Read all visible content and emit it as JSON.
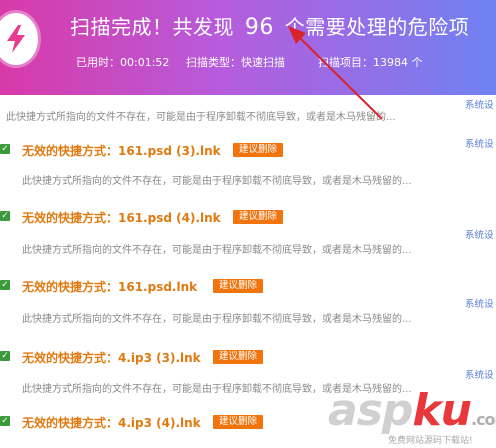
{
  "header": {
    "headline_prefix": "扫描完成！共发现",
    "count": "96",
    "headline_suffix": "个需要处理的危险项",
    "time_used": "已用时：00:01:52",
    "scan_type": "扫描类型：快速扫描",
    "scan_items": "扫描项目：13984 个",
    "logo_icon": "lightning-bolt-icon"
  },
  "desc_text": "此快捷方式所指向的文件不存在，可能是由于程序卸载不彻底导致，或者是木马残留的...",
  "tag_text": "系统设",
  "items": [
    {
      "title": "无效的快捷方式：161.psd (3).lnk",
      "action": "建议删除"
    },
    {
      "title": "无效的快捷方式：161.psd (4).lnk",
      "action": "建议删除"
    },
    {
      "title": "无效的快捷方式：161.psd.lnk",
      "action": "建议删除"
    },
    {
      "title": "无效的快捷方式：4.ip3 (3).lnk",
      "action": "建议删除"
    },
    {
      "title": "无效的快捷方式：4.ip3 (4).lnk",
      "action": "建议删除"
    }
  ],
  "watermark": {
    "asp": "asp",
    "ku": "ku",
    "suffix": ".com",
    "sub": "免费网站源码下载站!"
  },
  "colors": {
    "header_start": "#d83aa8",
    "header_end": "#6f82f2",
    "title_orange": "#e07a10",
    "button_orange": "#f0750f",
    "check_green": "#3a9a3a",
    "arrow_red": "#d8232a"
  }
}
